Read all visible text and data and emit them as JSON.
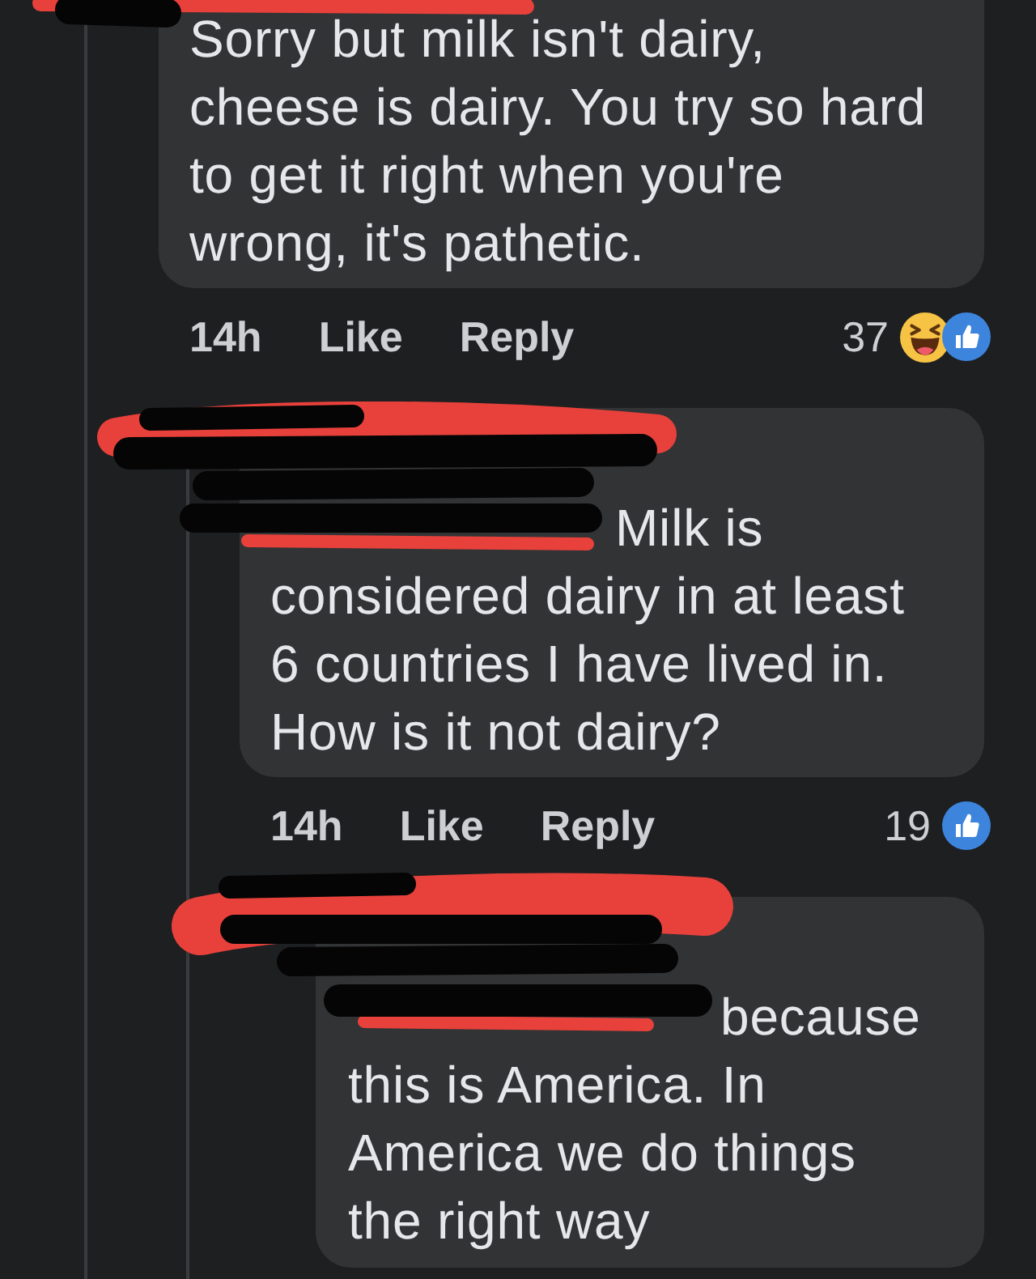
{
  "comments": [
    {
      "redacted": true,
      "text": "Sorry but milk isn't dairy, cheese is dairy. You try so hard to get it right when you're wrong, it's pathetic.",
      "time": "14h",
      "actions": [
        "Like",
        "Reply"
      ],
      "reaction_count": "37",
      "reactions": [
        {
          "kind": "haha"
        },
        {
          "kind": "like"
        }
      ],
      "replies": [
        {
          "redacted": true,
          "text": "Milk is considered dairy in at least 6 countries I have lived in. How is it not dairy?",
          "time": "14h",
          "actions": [
            "Like",
            "Reply"
          ],
          "reaction_count": "19",
          "reactions": [
            {
              "kind": "like"
            }
          ],
          "replies": [
            {
              "redacted": true,
              "text": "because this is America. In America we do things the right way"
            }
          ]
        }
      ]
    }
  ]
}
